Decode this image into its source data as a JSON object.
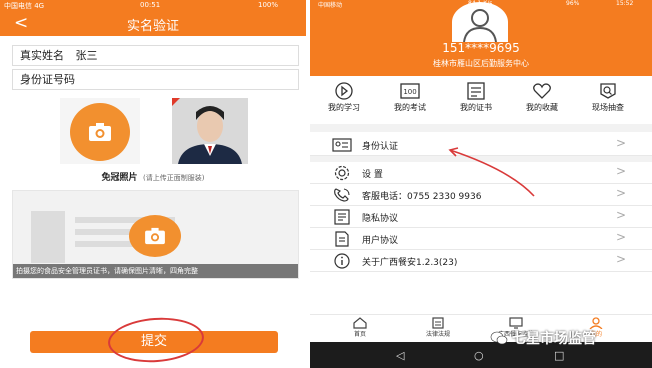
{
  "left": {
    "status": {
      "carrier": "中国电信 4G",
      "time": "00:51",
      "battery": "100%"
    },
    "header": {
      "title": "实名验证"
    },
    "name_field": {
      "label": "真实姓名",
      "value": "张三"
    },
    "id_field": {
      "label": "身份证号码"
    },
    "photo": {
      "label": "免冠照片",
      "hint": "(请上传正面制服装)"
    },
    "certificate": {
      "notice": "拍摄您的食品安全管理员证书，请确保图片清晰，四角完整"
    },
    "submit_label": "提交"
  },
  "right": {
    "status": {
      "carrier": "中国移动",
      "speed": "84.1 K/s",
      "battery": "96%",
      "time": "15:52"
    },
    "profile": {
      "phone": "151****9695",
      "org": "桂林市雁山区后勤服务中心"
    },
    "quick_links": [
      {
        "label": "我的学习",
        "icon": "play-icon"
      },
      {
        "label": "我的考试",
        "icon": "exam-100-icon"
      },
      {
        "label": "我的证书",
        "icon": "certificate-icon"
      },
      {
        "label": "我的收藏",
        "icon": "heart-icon"
      },
      {
        "label": "现场抽查",
        "icon": "inspect-icon"
      }
    ],
    "menu": [
      {
        "label": "身份认证",
        "icon": "id-card-icon"
      },
      {
        "label": "设    置",
        "icon": "gear-icon"
      },
      {
        "label": "客服电话：0755 2330 9936",
        "icon": "phone-icon"
      },
      {
        "label": "隐私协议",
        "icon": "document-icon"
      },
      {
        "label": "用户协议",
        "icon": "document-icon"
      },
      {
        "label": "关于广西餐安1.2.3(23)",
        "icon": "info-icon"
      }
    ],
    "tabs": [
      {
        "label": "首页",
        "icon": "home-icon"
      },
      {
        "label": "法律法规",
        "icon": "law-icon"
      },
      {
        "label": "广西餐安监管",
        "icon": "monitor-icon"
      },
      {
        "label": "我的",
        "icon": "user-icon"
      }
    ],
    "nav": {
      "back": "◁",
      "home": "○",
      "recent": "□"
    }
  },
  "watermark": "七星市场监管",
  "colors": {
    "accent": "#f47c20",
    "annotation": "#d93a3a"
  }
}
